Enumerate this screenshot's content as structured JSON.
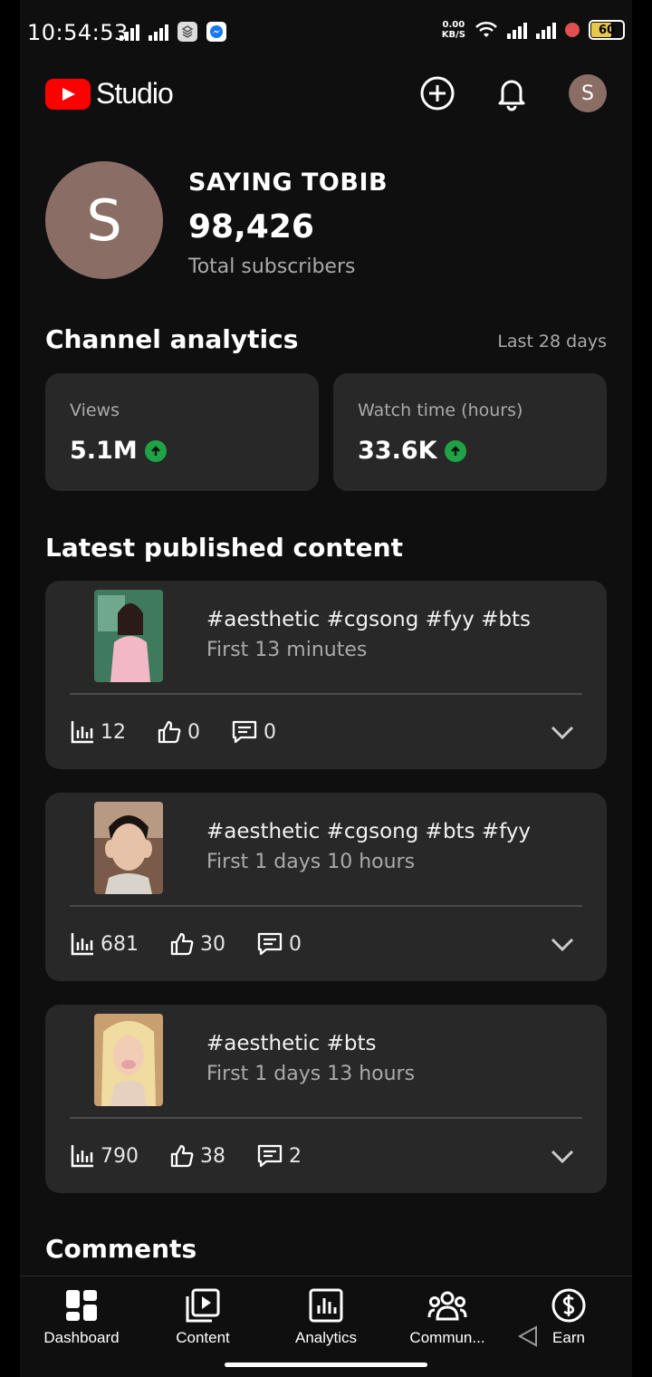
{
  "status_bar": {
    "time": "10:54:53",
    "net_speed_value": "0.00",
    "net_speed_unit": "KB/S",
    "battery": "60"
  },
  "header": {
    "logo_text": "Studio",
    "icons": [
      "add-circle-icon",
      "bell-icon"
    ],
    "avatar_letter": "S"
  },
  "channel": {
    "avatar_letter": "S",
    "name": "SAYING TOBIB",
    "subscribers": "98,426",
    "subscribers_label": "Total subscribers"
  },
  "analytics": {
    "title": "Channel analytics",
    "period": "Last 28 days",
    "cards": [
      {
        "label": "Views",
        "value": "5.1M",
        "trend": "up"
      },
      {
        "label": "Watch time (hours)",
        "value": "33.6K",
        "trend": "up"
      }
    ]
  },
  "latest": {
    "title": "Latest published content",
    "items": [
      {
        "title": "#aesthetic #cgsong #fyy #bts",
        "subtitle": "First 13 minutes",
        "views": "12",
        "likes": "0",
        "comments": "0"
      },
      {
        "title": "#aesthetic #cgsong #bts #fyy",
        "subtitle": "First 1 days 10 hours",
        "views": "681",
        "likes": "30",
        "comments": "0"
      },
      {
        "title": "#aesthetic #bts",
        "subtitle": "First 1 days 13 hours",
        "views": "790",
        "likes": "38",
        "comments": "2"
      }
    ]
  },
  "comments": {
    "title": "Comments"
  },
  "nav": {
    "items": [
      {
        "label": "Dashboard",
        "icon": "dashboard-icon"
      },
      {
        "label": "Content",
        "icon": "content-icon"
      },
      {
        "label": "Analytics",
        "icon": "analytics-icon"
      },
      {
        "label": "Commun...",
        "icon": "community-icon"
      },
      {
        "label": "Earn",
        "icon": "earn-icon"
      }
    ]
  },
  "colors": {
    "background": "#0f0f0f",
    "card": "#282828",
    "trend_up": "#1ea446",
    "brand": "#ff0000"
  }
}
